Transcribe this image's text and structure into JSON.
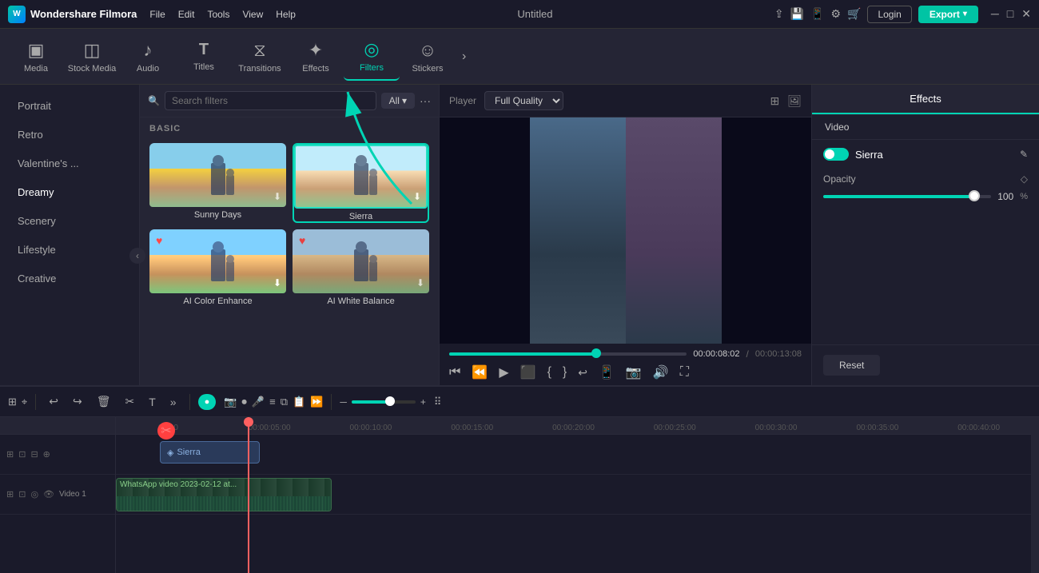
{
  "app": {
    "name": "Wondershare Filmora",
    "title": "Untitled",
    "logo_text": "W"
  },
  "titlebar": {
    "menus": [
      "File",
      "Edit",
      "Tools",
      "View",
      "Help"
    ],
    "login_label": "Login",
    "export_label": "Export",
    "window_controls": [
      "─",
      "□",
      "✕"
    ]
  },
  "toolbar": {
    "items": [
      {
        "id": "media",
        "label": "Media",
        "icon": "▣"
      },
      {
        "id": "stock-media",
        "label": "Stock Media",
        "icon": "◫"
      },
      {
        "id": "audio",
        "label": "Audio",
        "icon": "♪"
      },
      {
        "id": "titles",
        "label": "Titles",
        "icon": "T"
      },
      {
        "id": "transitions",
        "label": "Transitions",
        "icon": "⧖"
      },
      {
        "id": "effects",
        "label": "Effects",
        "icon": "✦"
      },
      {
        "id": "filters",
        "label": "Filters",
        "icon": "◎"
      },
      {
        "id": "stickers",
        "label": "Stickers",
        "icon": "☺"
      }
    ],
    "more_label": "›",
    "active": "filters"
  },
  "filters": {
    "search_placeholder": "Search filters",
    "all_label": "All",
    "section_basic": "BASIC",
    "categories": [
      {
        "id": "portrait",
        "label": "Portrait"
      },
      {
        "id": "retro",
        "label": "Retro"
      },
      {
        "id": "valentines",
        "label": "Valentine's ..."
      },
      {
        "id": "dreamy",
        "label": "Dreamy"
      },
      {
        "id": "scenery",
        "label": "Scenery"
      },
      {
        "id": "lifestyle",
        "label": "Lifestyle"
      },
      {
        "id": "creative",
        "label": "Creative"
      }
    ],
    "items": [
      {
        "id": "sunny-days",
        "name": "Sunny Days",
        "selected": false,
        "heart": false
      },
      {
        "id": "sierra",
        "name": "Sierra",
        "selected": true,
        "heart": false
      },
      {
        "id": "ai-color-enhance",
        "name": "AI Color Enhance",
        "selected": false,
        "heart": true
      },
      {
        "id": "ai-white-balance",
        "name": "AI White Balance",
        "selected": false,
        "heart": true
      }
    ]
  },
  "player": {
    "label": "Player",
    "quality": "Full Quality",
    "time_current": "00:00:08:02",
    "time_total": "00:00:13:08",
    "progress_percent": 62
  },
  "right_panel": {
    "effects_tab": "Effects",
    "video_tab": "Video",
    "filter_name": "Sierra",
    "opacity_label": "Opacity",
    "opacity_value": "100",
    "opacity_unit": "%",
    "reset_label": "Reset"
  },
  "timeline": {
    "ruler_marks": [
      "00:00",
      "00:00:05:00",
      "00:00:10:00",
      "00:00:15:00",
      "00:00:20:00",
      "00:00:25:00",
      "00:00:30:00",
      "00:00:35:00",
      "00:00:40:00"
    ],
    "tracks": [
      {
        "type": "filter",
        "label": ""
      },
      {
        "type": "video",
        "label": "Video 1"
      }
    ],
    "filter_clip_label": "Sierra",
    "video_clip_label": "WhatsApp video 2023-02-12 at..."
  }
}
